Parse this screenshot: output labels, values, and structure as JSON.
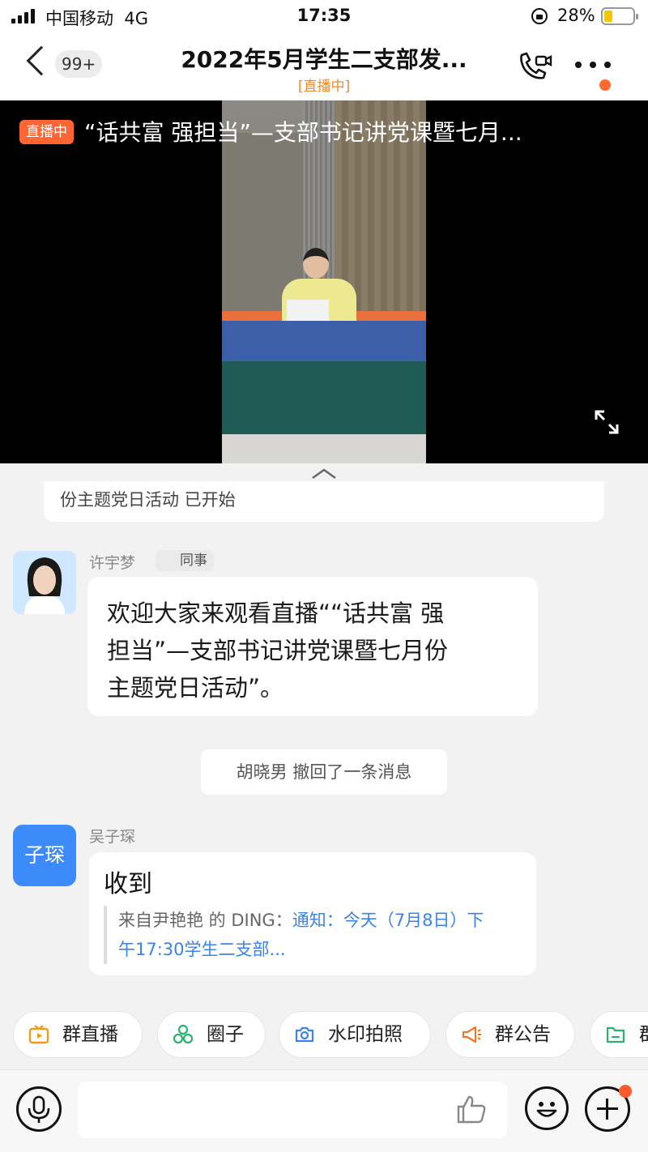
{
  "status_bar": {
    "carrier": "中国移动",
    "network": "4G",
    "time": "17:35",
    "battery_percent": "28%",
    "battery_level": 0.28
  },
  "header": {
    "back_badge": "99+",
    "title": "2022年5月学生二支部发...",
    "subtitle": "[直播中]",
    "icons": [
      "back-icon",
      "video-call-icon",
      "more-icon"
    ]
  },
  "video": {
    "live_tag": "直播中",
    "title": "“话共富  强担当”—支部书记讲党课暨七月...",
    "icons": [
      "fullscreen-icon"
    ]
  },
  "system_card": {
    "text": "份主题党日活动 已开始"
  },
  "messages": [
    {
      "sender": "许宇梦",
      "tag": "同事",
      "text_lines": [
        "欢迎大家来观看直播““话共富  强",
        "担当”—支部书记讲党课暨七月份",
        "主题党日活动”。"
      ]
    },
    {
      "system": "胡晓男 撤回了一条消息"
    },
    {
      "sender": "吴子琛",
      "avatar_text": "子琛",
      "text": "收到",
      "quote_prefix": "来自尹艳艳 的 DING：",
      "quote_link_line1": "通知：今天（7月8日）下",
      "quote_link_line2": "午17:30学生二支部..."
    }
  ],
  "quick_actions": [
    {
      "label": "群直播",
      "icon": "live-tv-icon",
      "color": "#f29a1e"
    },
    {
      "label": "圈子",
      "icon": "circles-icon",
      "color": "#26b36b"
    },
    {
      "label": "水印拍照",
      "icon": "camera-icon",
      "color": "#3a83ea"
    },
    {
      "label": "群公告",
      "icon": "megaphone-icon",
      "color": "#f07428"
    },
    {
      "label": "群",
      "icon": "folder-icon",
      "color": "#26b36b"
    }
  ],
  "input_bar": {
    "placeholder": "",
    "icons": [
      "voice-icon",
      "thumbs-up-icon",
      "emoji-icon",
      "plus-icon"
    ]
  },
  "colors": {
    "accent_orange": "#ff6633",
    "link_blue": "#3a83ea",
    "avatar_blue": "#3d8bfa"
  }
}
